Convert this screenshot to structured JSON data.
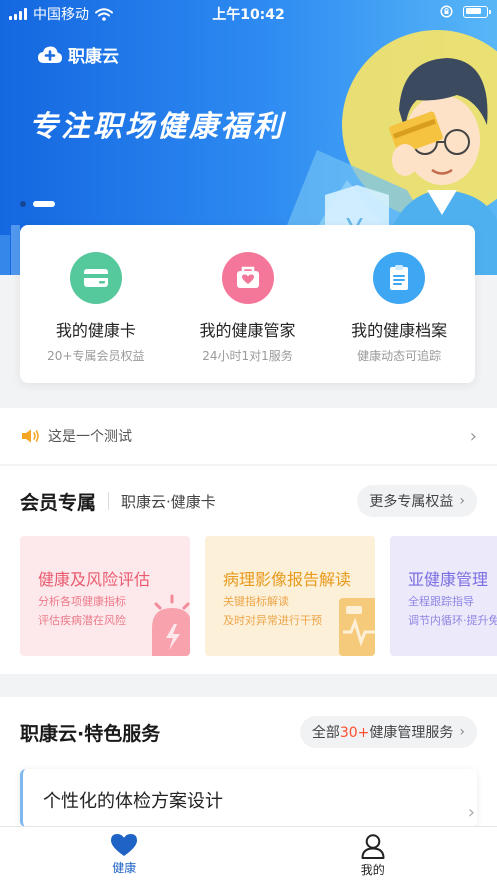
{
  "status_bar": {
    "carrier": "中国移动",
    "time": "上午10:42"
  },
  "banner": {
    "logo_text": "职康云",
    "slogan": "专注职场健康福利"
  },
  "quick_links": [
    {
      "title": "我的健康卡",
      "subtitle": "20+专属会员权益",
      "icon": "card-icon",
      "color": "#52c89a"
    },
    {
      "title": "我的健康管家",
      "subtitle": "24小时1对1服务",
      "icon": "steward-icon",
      "color": "#f36b8d"
    },
    {
      "title": "我的健康档案",
      "subtitle": "健康动态可追踪",
      "icon": "document-icon",
      "color": "#3aa4f3"
    }
  ],
  "notice": {
    "text": "这是一个测试",
    "icon": "speaker-icon"
  },
  "member_section": {
    "title": "会员专属",
    "subtitle": "职康云·健康卡",
    "more_label": "更多专属权益",
    "cards": [
      {
        "title": "健康及风险评估",
        "lines": [
          "分析各项健康指标",
          "评估疾病潜在风险"
        ],
        "bg": "#fde9ec",
        "accent": "#ea5a6e",
        "sub_color": "#ec7a89"
      },
      {
        "title": "病理影像报告解读",
        "lines": [
          "关键指标解读",
          "及时对异常进行干预"
        ],
        "bg": "#fdf0d9",
        "accent": "#e79a1c",
        "sub_color": "#eca64a"
      },
      {
        "title": "亚健康管理",
        "lines": [
          "全程跟踪指导",
          "调节内循环·提升免疫"
        ],
        "bg": "#ece9fb",
        "accent": "#7a6fe0",
        "sub_color": "#8f86e4"
      }
    ]
  },
  "special_section": {
    "title": "职康云·特色服务",
    "more_prefix": "全部",
    "more_highlight": "30+",
    "more_suffix": "健康管理服务",
    "items": [
      {
        "title": "个性化的体检方案设计"
      }
    ]
  },
  "tabbar": {
    "active_color": "#1f63c6",
    "tabs": [
      {
        "label": "健康",
        "icon": "heart-icon",
        "active": true
      },
      {
        "label": "我的",
        "icon": "person-icon",
        "active": false
      }
    ]
  }
}
